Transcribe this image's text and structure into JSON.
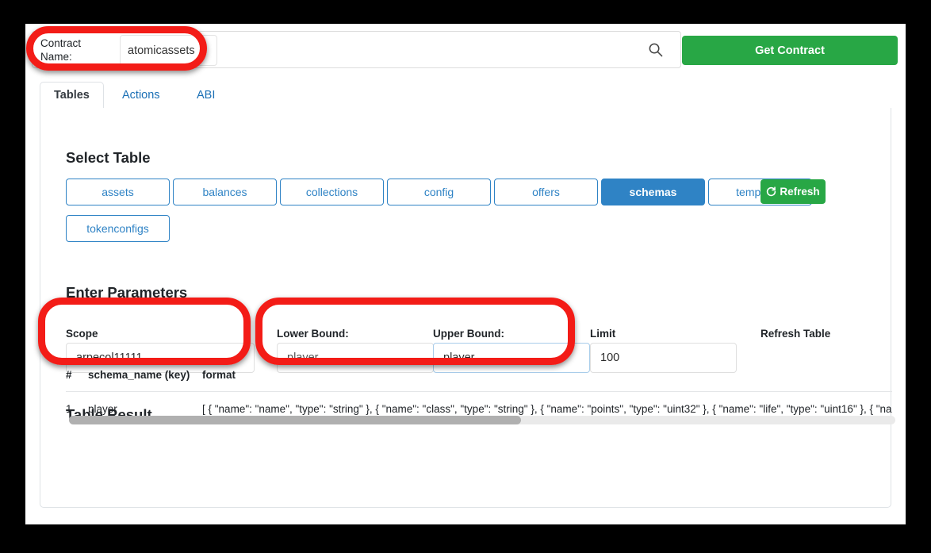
{
  "topbar": {
    "contract_label": "Contract\nName:",
    "contract_value": "atomicassets",
    "search_placeholder": "",
    "search_icon": "search-icon",
    "get_contract_label": "Get Contract",
    "accent_green": "#28a745"
  },
  "tabs": [
    {
      "label": "Tables",
      "active": true
    },
    {
      "label": "Actions",
      "active": false
    },
    {
      "label": "ABI",
      "active": false
    }
  ],
  "select_table": {
    "title": "Select Table",
    "buttons": [
      {
        "label": "assets",
        "selected": false
      },
      {
        "label": "balances",
        "selected": false
      },
      {
        "label": "collections",
        "selected": false
      },
      {
        "label": "config",
        "selected": false
      },
      {
        "label": "offers",
        "selected": false
      },
      {
        "label": "schemas",
        "selected": true
      },
      {
        "label": "templates",
        "selected": false
      },
      {
        "label": "tokenconfigs",
        "selected": false
      }
    ],
    "selected_color": "#2f83c5"
  },
  "parameters": {
    "title": "Enter Parameters",
    "scope": {
      "label": "Scope",
      "value": "arpecol11111"
    },
    "lower_bound": {
      "label": "Lower Bound:",
      "value": "player"
    },
    "upper_bound": {
      "label": "Upper Bound:",
      "value": "player"
    },
    "limit": {
      "label": "Limit",
      "value": "100"
    },
    "refresh": {
      "label": "Refresh Table",
      "button_label": "Refresh",
      "icon": "refresh-icon"
    }
  },
  "result": {
    "title": "Table Result",
    "columns": [
      "#",
      "schema_name (key)",
      "format"
    ],
    "rows": [
      {
        "num": "1",
        "schema_name": "player",
        "format": "[ { \"name\": \"name\", \"type\": \"string\" }, { \"name\": \"class\", \"type\": \"string\" }, { \"name\": \"points\", \"type\": \"uint32\" }, { \"name\": \"life\", \"type\": \"uint16\" }, { \"name\": \"img\", \"type\": \"image\" } ]"
      }
    ]
  },
  "annotations": {
    "color": "#f31c17",
    "highlights": [
      "contract-name-field",
      "scope-field",
      "bounds-fields"
    ]
  }
}
